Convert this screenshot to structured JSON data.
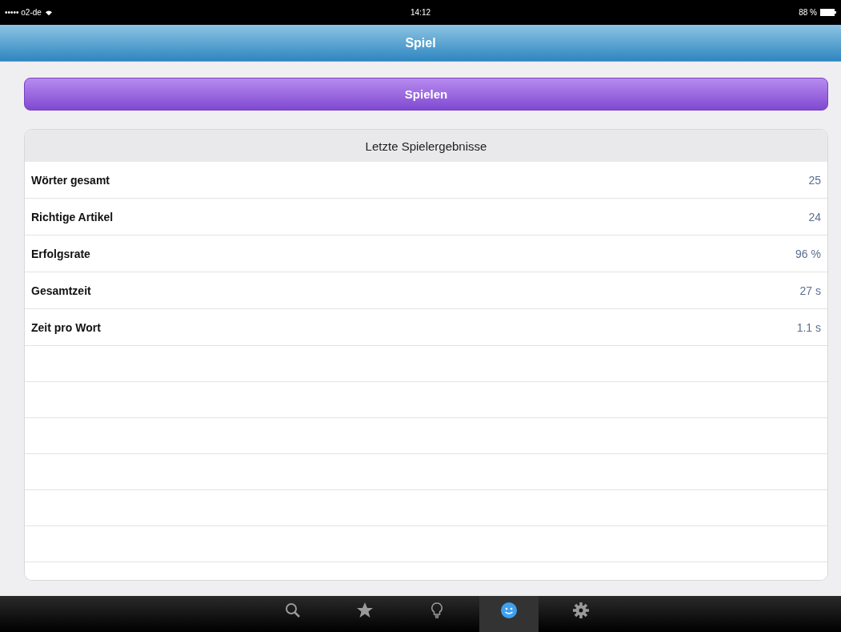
{
  "status_bar": {
    "carrier": "••••• o2-de",
    "time": "14:12",
    "battery": "88 %"
  },
  "nav_bar": {
    "title": "Spiel"
  },
  "play_button": {
    "label": "Spielen"
  },
  "results": {
    "title": "Letzte Spielergebnisse",
    "rows": [
      {
        "label": "Wörter gesamt",
        "value": "25"
      },
      {
        "label": "Richtige Artikel",
        "value": "24"
      },
      {
        "label": "Erfolgsrate",
        "value": "96 %"
      },
      {
        "label": "Gesamtzeit",
        "value": "27 s"
      },
      {
        "label": "Zeit pro Wort",
        "value": "1.1 s"
      }
    ]
  },
  "tab_bar": {
    "tabs": [
      {
        "kind": "search",
        "selected": false
      },
      {
        "kind": "star",
        "selected": false
      },
      {
        "kind": "bulb",
        "selected": false
      },
      {
        "kind": "smiley",
        "selected": true
      },
      {
        "kind": "gear",
        "selected": false
      }
    ]
  }
}
